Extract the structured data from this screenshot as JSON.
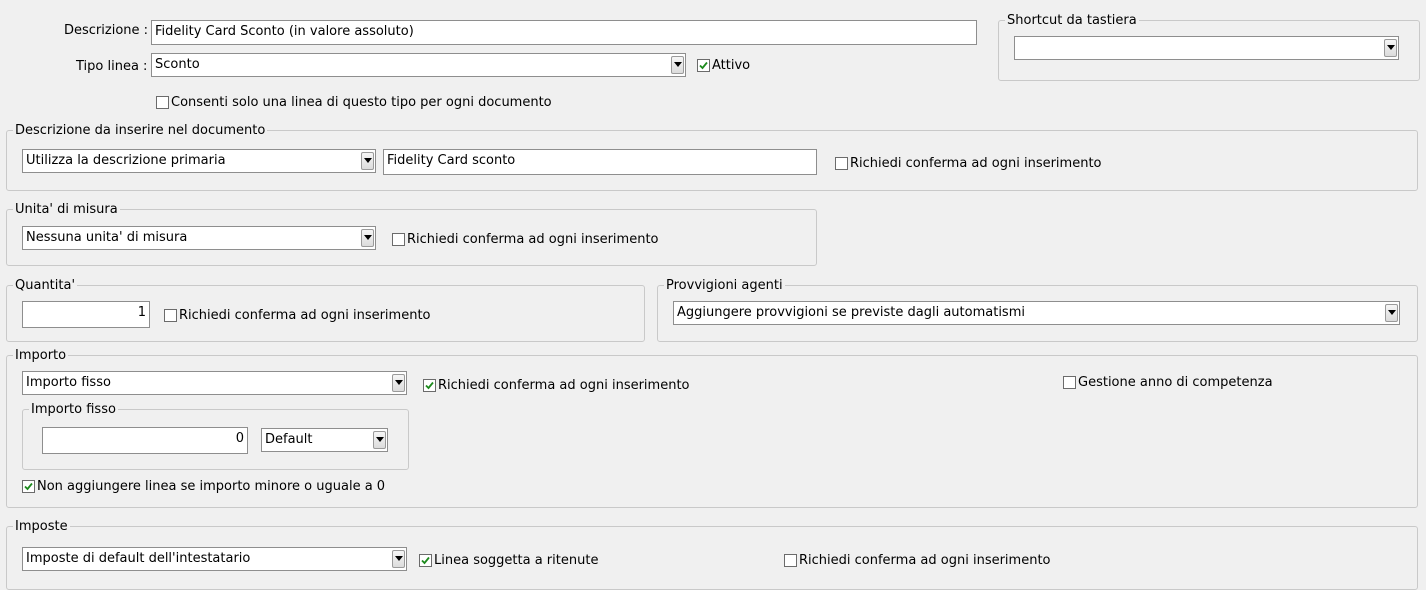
{
  "main": {
    "descrizione_label": "Descrizione :",
    "descrizione_value": "Fidelity Card Sconto (in valore assoluto)",
    "tipo_linea_label": "Tipo linea :",
    "tipo_linea_value": "Sconto",
    "attivo_label": "Attivo",
    "attivo_checked": true,
    "consenti_label": "Consenti solo una linea di questo tipo per ogni documento",
    "consenti_checked": false
  },
  "shortcut": {
    "title": "Shortcut da tastiera",
    "value": ""
  },
  "descrizione_doc": {
    "title": "Descrizione da inserire nel documento",
    "combo_value": "Utilizza la descrizione primaria",
    "text_value": "Fidelity Card sconto",
    "conferma_label": "Richiedi conferma ad ogni inserimento",
    "conferma_checked": false
  },
  "unita": {
    "title": "Unita' di misura",
    "combo_value": "Nessuna unita' di misura",
    "conferma_label": "Richiedi conferma ad ogni inserimento",
    "conferma_checked": false
  },
  "quantita": {
    "title": "Quantita'",
    "value": "1",
    "conferma_label": "Richiedi conferma ad ogni inserimento",
    "conferma_checked": false
  },
  "provvigioni": {
    "title": "Provvigioni agenti",
    "combo_value": "Aggiungere provvigioni se previste dagli automatismi"
  },
  "importo": {
    "title": "Importo",
    "combo_value": "Importo fisso",
    "conferma_label": "Richiedi conferma ad ogni inserimento",
    "conferma_checked": true,
    "gestione_label": "Gestione anno di competenza",
    "gestione_checked": false,
    "fisso_title": "Importo fisso",
    "fisso_value": "0",
    "fisso_currency": "Default",
    "non_aggiungere_label": "Non aggiungere linea se importo minore o uguale a 0",
    "non_aggiungere_checked": true
  },
  "imposte": {
    "title": "Imposte",
    "combo_value": "Imposte di default dell'intestatario",
    "ritenute_label": "Linea soggetta a ritenute",
    "ritenute_checked": true,
    "conferma_label": "Richiedi conferma ad ogni inserimento",
    "conferma_checked": false
  }
}
